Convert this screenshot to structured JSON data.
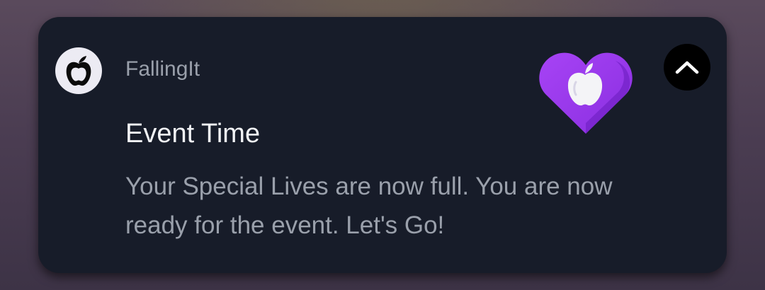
{
  "notification": {
    "app_icon": "apple-icon",
    "app_name": "FallingIt",
    "title": "Event Time",
    "message": "Your Special Lives are now full. You are now ready for the event. Let's Go!",
    "large_icon": "purple-heart-apple-icon",
    "collapse_icon": "chevron-up-icon"
  },
  "colors": {
    "card_background": "#171c29",
    "title": "#f2f3f6",
    "secondary_text": "#9aa0ab",
    "heart_purple": "#9b3cf0",
    "collapse_button": "#000000"
  }
}
